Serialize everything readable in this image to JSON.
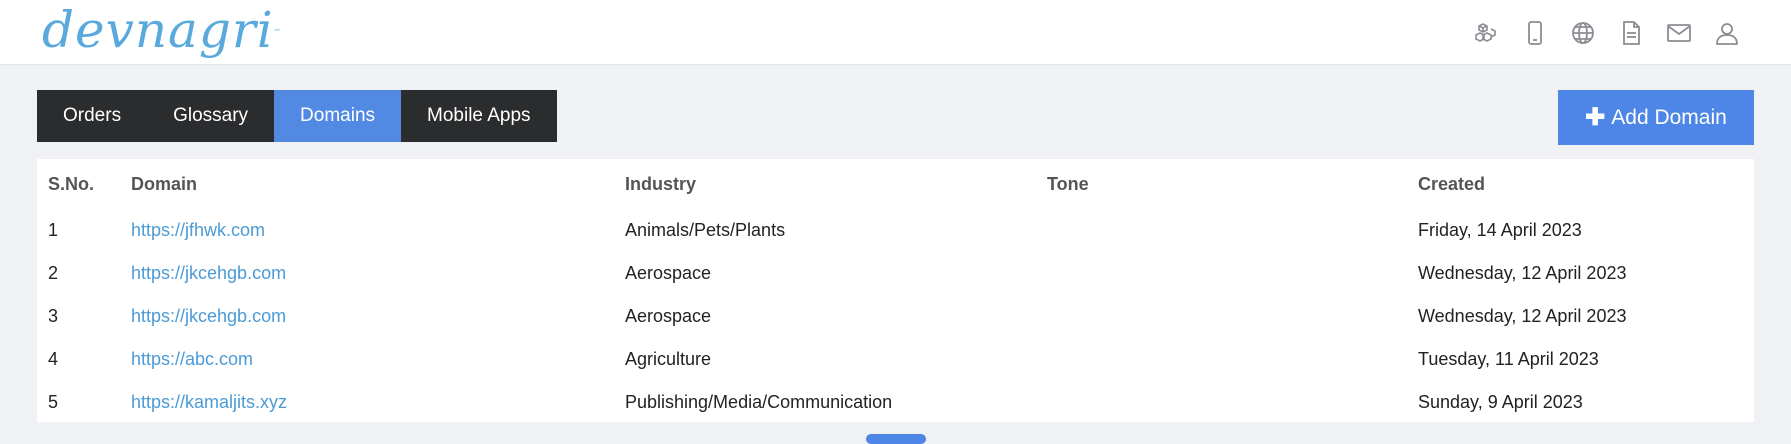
{
  "brand": {
    "logo_text": "devnagri",
    "tm": "™"
  },
  "header_icons": [
    "cubes-icon",
    "mobile-icon",
    "globe-icon",
    "document-icon",
    "mail-icon",
    "user-icon"
  ],
  "tabs": [
    {
      "label": "Orders",
      "active": false
    },
    {
      "label": "Glossary",
      "active": false
    },
    {
      "label": "Domains",
      "active": true
    },
    {
      "label": "Mobile Apps",
      "active": false
    }
  ],
  "actions": {
    "add_domain": "Add Domain"
  },
  "table": {
    "headers": {
      "sno": "S.No.",
      "domain": "Domain",
      "industry": "Industry",
      "tone": "Tone",
      "created": "Created"
    },
    "rows": [
      {
        "sno": "1",
        "domain": "https://jfhwk.com",
        "industry": "Animals/Pets/Plants",
        "tone": "",
        "created": "Friday, 14 April 2023"
      },
      {
        "sno": "2",
        "domain": "https://jkcehgb.com",
        "industry": "Aerospace",
        "tone": "",
        "created": "Wednesday, 12 April 2023"
      },
      {
        "sno": "3",
        "domain": "https://jkcehgb.com",
        "industry": "Aerospace",
        "tone": "",
        "created": "Wednesday, 12 April 2023"
      },
      {
        "sno": "4",
        "domain": "https://abc.com",
        "industry": "Agriculture",
        "tone": "",
        "created": "Tuesday, 11 April 2023"
      },
      {
        "sno": "5",
        "domain": "https://kamaljits.xyz",
        "industry": "Publishing/Media/Communication",
        "tone": "",
        "created": "Sunday, 9 April 2023"
      }
    ]
  },
  "colors": {
    "accent": "#4d86e6",
    "tab_dark": "#2b2c2e",
    "link": "#4b9bd6",
    "logo": "#5aa9dd"
  }
}
